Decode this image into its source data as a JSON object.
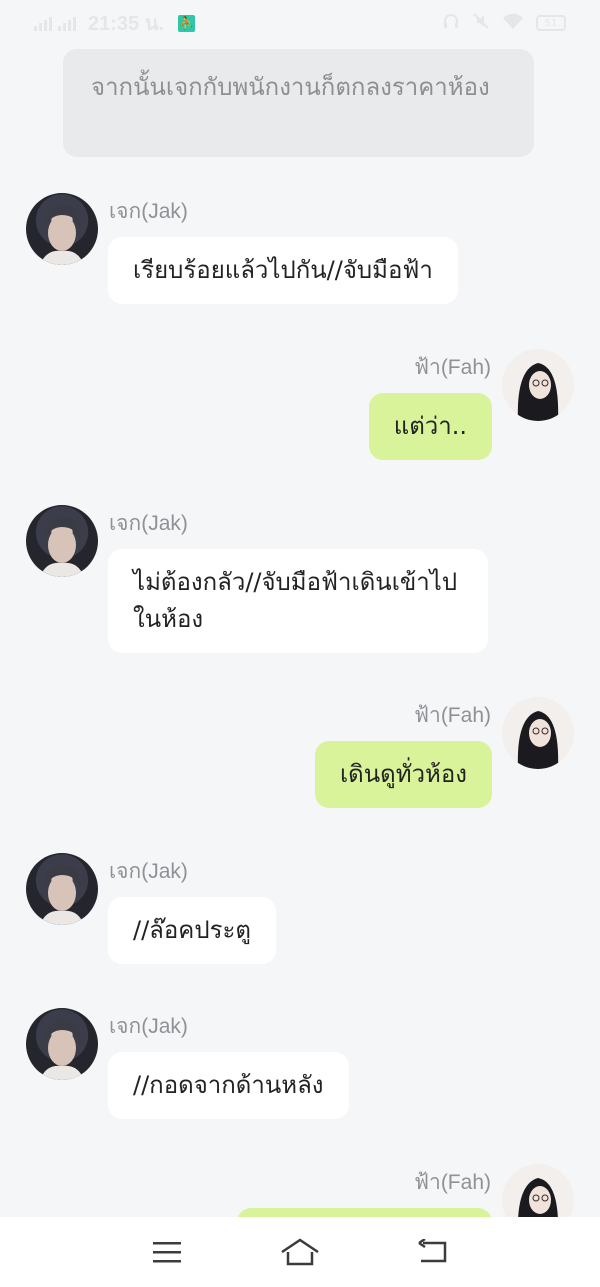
{
  "status_bar": {
    "signal_1_label": "4G",
    "signal_2_label": "4G",
    "time": "21:35 น.",
    "battery": "51"
  },
  "narration": "จากนั้นเจกกับพนักงานก็ตกลงราคาห้อง",
  "messages": [
    {
      "side": "left",
      "name": "เจก(Jak)",
      "text": "เรียบร้อยแล้วไปกัน//จับมือฟ้า"
    },
    {
      "side": "right",
      "name": "ฟ้า(Fah)",
      "text": "แต่ว่า.."
    },
    {
      "side": "left",
      "name": "เจก(Jak)",
      "text": "ไม่ต้องกลัว//จับมือฟ้าเดินเข้าไปในห้อง"
    },
    {
      "side": "right",
      "name": "ฟ้า(Fah)",
      "text": "เดินดูทั่วห้อง"
    },
    {
      "side": "left",
      "name": "เจก(Jak)",
      "text": "//ล๊อคประตู"
    },
    {
      "side": "left",
      "name": "เจก(Jak)",
      "text": "//กอดจากด้านหลัง"
    },
    {
      "side": "right",
      "name": "ฟ้า(Fah)",
      "text": ""
    }
  ],
  "navbar": {
    "icons": [
      "menu-icon",
      "home-icon",
      "back-icon"
    ]
  }
}
